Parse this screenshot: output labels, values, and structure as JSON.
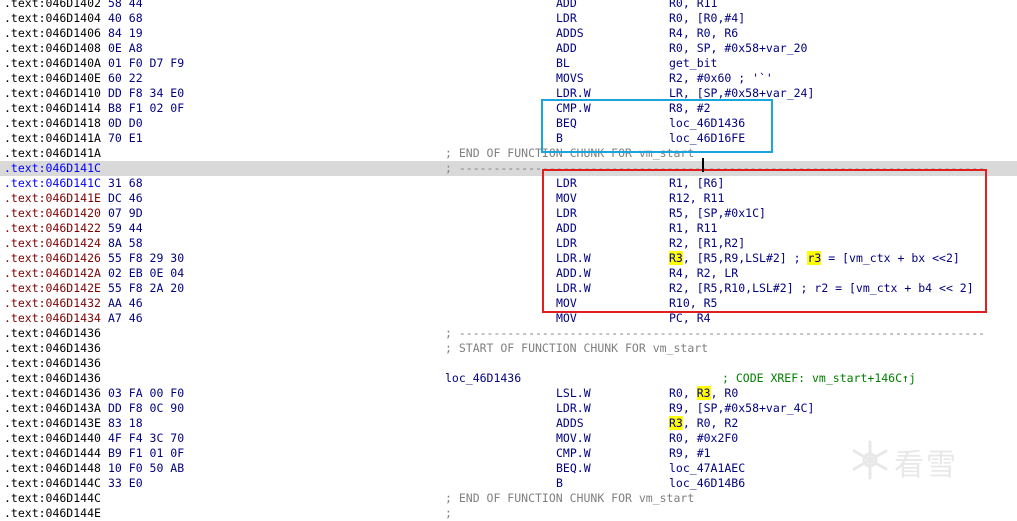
{
  "listing": {
    "lines": [
      {
        "addr": ".text:046D1402",
        "bytes": "58 44",
        "mnem": "ADD",
        "ops": "R0, R11"
      },
      {
        "addr": ".text:046D1404",
        "bytes": "40 68",
        "mnem": "LDR",
        "ops": "R0, [R0,#4]"
      },
      {
        "addr": ".text:046D1406",
        "bytes": "84 19",
        "mnem": "ADDS",
        "ops": "R4, R0, R6"
      },
      {
        "addr": ".text:046D1408",
        "bytes": "0E A8",
        "mnem": "ADD",
        "ops": "R0, SP, #0x58+var_20"
      },
      {
        "addr": ".text:046D140A",
        "bytes": "01 F0 D7 F9",
        "mnem": "BL",
        "ops": "get_bit"
      },
      {
        "addr": ".text:046D140E",
        "bytes": "60 22",
        "mnem": "MOVS",
        "ops": "R2, #0x60 ; '`'"
      },
      {
        "addr": ".text:046D1410",
        "bytes": "DD F8 34 E0",
        "mnem": "LDR.W",
        "ops": "LR, [SP,#0x58+var_24]"
      },
      {
        "addr": ".text:046D1414",
        "bytes": "B8 F1 02 0F",
        "mnem": "CMP.W",
        "ops": "R8, #2"
      },
      {
        "addr": ".text:046D1418",
        "bytes": "0D D0",
        "mnem": "BEQ",
        "ops": "loc_46D1436"
      },
      {
        "addr": ".text:046D141A",
        "bytes": "70 E1",
        "mnem": "B",
        "ops": "loc_46D16FE"
      },
      {
        "addr": ".text:046D141A",
        "cmt": "; END OF FUNCTION CHUNK FOR vm_start"
      },
      {
        "addr": ".text:046D141C",
        "sep": "; -----------------------------------------------------------------------------------------------",
        "current": true,
        "addr_color": "blue"
      },
      {
        "addr": ".text:046D141C",
        "bytes": "31 68",
        "mnem": "LDR",
        "ops": "R1, [R6]",
        "addr_color": "blue"
      },
      {
        "addr": ".text:046D141E",
        "bytes": "DC 46",
        "mnem": "MOV",
        "ops": "R12, R11",
        "addr_color": "red"
      },
      {
        "addr": ".text:046D1420",
        "bytes": "07 9D",
        "mnem": "LDR",
        "ops": "R5, [SP,#0x1C]",
        "addr_color": "red"
      },
      {
        "addr": ".text:046D1422",
        "bytes": "59 44",
        "mnem": "ADD",
        "ops": "R1, R11",
        "addr_color": "red"
      },
      {
        "addr": ".text:046D1424",
        "bytes": "8A 58",
        "mnem": "LDR",
        "ops": "R2, [R1,R2]",
        "addr_color": "red"
      },
      {
        "addr": ".text:046D1426",
        "bytes": "55 F8 29 30",
        "mnem": "LDR.W",
        "ops_hl": "R3",
        "ops_rest": ", [R5,R9,LSL#2] ; ",
        "ops_hl2": "r3",
        "ops_rest2": " = [vm_ctx + bx <<2]",
        "addr_color": "red"
      },
      {
        "addr": ".text:046D142A",
        "bytes": "02 EB 0E 04",
        "mnem": "ADD.W",
        "ops": "R4, R2, LR",
        "addr_color": "red"
      },
      {
        "addr": ".text:046D142E",
        "bytes": "55 F8 2A 20",
        "mnem": "LDR.W",
        "ops": "R2, [R5,R10,LSL#2] ; r2 = [vm_ctx + b4 << 2]",
        "addr_color": "red"
      },
      {
        "addr": ".text:046D1432",
        "bytes": "AA 46",
        "mnem": "MOV",
        "ops": "R10, R5",
        "addr_color": "red"
      },
      {
        "addr": ".text:046D1434",
        "bytes": "A7 46",
        "mnem": "MOV",
        "ops": "PC, R4",
        "addr_color": "red"
      },
      {
        "addr": ".text:046D1436",
        "sep": "; -----------------------------------------------------------------------------------------------"
      },
      {
        "addr": ".text:046D1436",
        "cmt": "; START OF FUNCTION CHUNK FOR vm_start"
      },
      {
        "addr": ".text:046D1436"
      },
      {
        "addr": ".text:046D1436",
        "label": "loc_46D1436",
        "xref": "; CODE XREF: vm_start+146C↑j"
      },
      {
        "addr": ".text:046D1436",
        "bytes": "03 FA 00 F0",
        "mnem": "LSL.W",
        "ops_pre": "R0, ",
        "ops_hl": "R3",
        "ops_rest": ", R0"
      },
      {
        "addr": ".text:046D143A",
        "bytes": "DD F8 0C 90",
        "mnem": "LDR.W",
        "ops": "R9, [SP,#0x58+var_4C]"
      },
      {
        "addr": ".text:046D143E",
        "bytes": "83 18",
        "mnem": "ADDS",
        "ops_hl": "R3",
        "ops_rest": ", R0, R2"
      },
      {
        "addr": ".text:046D1440",
        "bytes": "4F F4 3C 70",
        "mnem": "MOV.W",
        "ops": "R0, #0x2F0"
      },
      {
        "addr": ".text:046D1444",
        "bytes": "B9 F1 01 0F",
        "mnem": "CMP.W",
        "ops": "R9, #1"
      },
      {
        "addr": ".text:046D1448",
        "bytes": "10 F0 50 AB",
        "mnem": "BEQ.W",
        "ops": "loc_47A1AEC"
      },
      {
        "addr": ".text:046D144C",
        "bytes": "33 E0",
        "mnem": "B",
        "ops": "loc_46D14B6"
      },
      {
        "addr": ".text:046D144C",
        "cmt": "; END OF FUNCTION CHUNK FOR vm_start"
      },
      {
        "addr": ".text:046D144E",
        "sep": ";"
      }
    ]
  },
  "watermark": {
    "text": "看雪",
    "icon": "snowflake-icon"
  },
  "colors": {
    "blue_box": "#1aa6dc",
    "red_box": "#e02020",
    "highlight": "#ffff00"
  }
}
